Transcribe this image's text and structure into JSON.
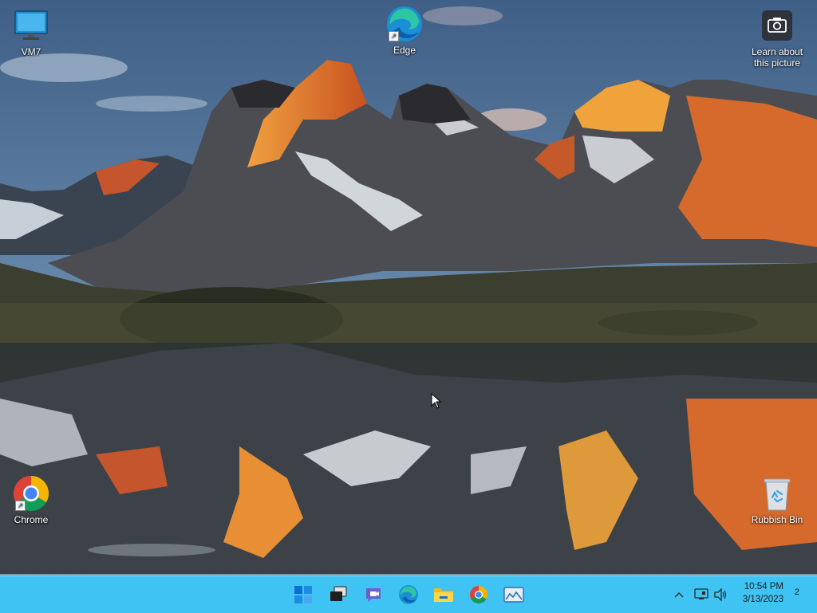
{
  "desktop": {
    "icons": {
      "vm7": {
        "label": "VM7",
        "icon": "monitor-icon"
      },
      "edge": {
        "label": "Edge",
        "icon": "edge-icon"
      },
      "learn": {
        "label_line1": "Learn about",
        "label_line2": "this picture",
        "icon": "camera-icon"
      },
      "chrome": {
        "label": "Chrome",
        "icon": "chrome-icon"
      },
      "recycle": {
        "label": "Rubbish Bin",
        "icon": "recycle-bin-icon"
      }
    }
  },
  "taskbar": {
    "apps": [
      "start-icon",
      "task-view-icon",
      "teams-chat-icon",
      "edge-icon",
      "file-explorer-icon",
      "chrome-icon",
      "photos-icon"
    ],
    "tray": {
      "clock_time": "10:54 PM",
      "clock_date": "3/13/2023",
      "notification_count": "2"
    }
  },
  "colors": {
    "taskbar": "#3fc3f3",
    "sky": "#4f6f91",
    "alpenglow": "#e0712a"
  }
}
